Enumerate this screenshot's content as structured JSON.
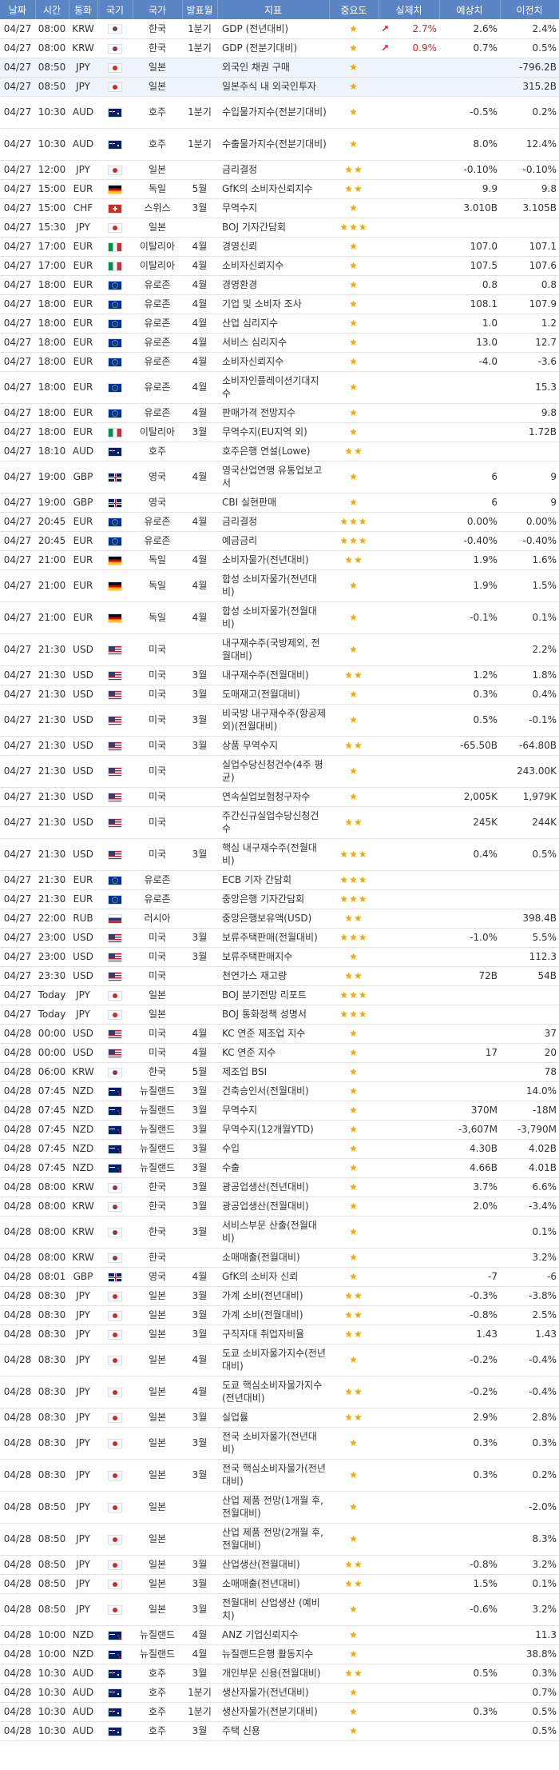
{
  "headers": [
    "날짜",
    "시간",
    "통화",
    "국기",
    "국가",
    "발표월",
    "지표",
    "중요도",
    "실제치",
    "예상치",
    "이전치"
  ],
  "rows": [
    [
      "04/27",
      "08:00",
      "KRW",
      "kr",
      "한국",
      "1분기",
      "GDP (전년대비)",
      1,
      "2.7%",
      "2.6%",
      "2.4%",
      "up"
    ],
    [
      "04/27",
      "08:00",
      "KRW",
      "kr",
      "한국",
      "1분기",
      "GDP (전분기대비)",
      1,
      "0.9%",
      "0.7%",
      "0.5%",
      "up"
    ],
    [
      "04/27",
      "08:50",
      "JPY",
      "jp",
      "일본",
      "",
      "외국인 채권 구매",
      1,
      "",
      "",
      "-796.2B",
      ""
    ],
    [
      "04/27",
      "08:50",
      "JPY",
      "jp",
      "일본",
      "",
      "일본주식 내 외국인투자",
      1,
      "",
      "",
      "315.2B",
      ""
    ],
    [
      "04/27",
      "10:30",
      "AUD",
      "au",
      "호주",
      "1분기",
      "수입물가지수(전분기대비)",
      1,
      "",
      "-0.5%",
      "0.2%",
      ""
    ],
    [
      "04/27",
      "10:30",
      "AUD",
      "au",
      "호주",
      "1분기",
      "수출물가지수(전분기대비)",
      1,
      "",
      "8.0%",
      "12.4%",
      ""
    ],
    [
      "04/27",
      "12:00",
      "JPY",
      "jp",
      "일본",
      "",
      "금리결정",
      2,
      "",
      "-0.10%",
      "-0.10%",
      ""
    ],
    [
      "04/27",
      "15:00",
      "EUR",
      "de",
      "독일",
      "5월",
      "GfK의 소비자신뢰지수",
      2,
      "",
      "9.9",
      "9.8",
      ""
    ],
    [
      "04/27",
      "15:00",
      "CHF",
      "ch",
      "스위스",
      "3월",
      "무역수지",
      1,
      "",
      "3.010B",
      "3.105B",
      ""
    ],
    [
      "04/27",
      "15:30",
      "JPY",
      "jp",
      "일본",
      "",
      "BOJ 기자간담회",
      3,
      "",
      "",
      "",
      ""
    ],
    [
      "04/27",
      "17:00",
      "EUR",
      "it",
      "이탈리아",
      "4월",
      "경영신뢰",
      1,
      "",
      "107.0",
      "107.1",
      ""
    ],
    [
      "04/27",
      "17:00",
      "EUR",
      "it",
      "이탈리아",
      "4월",
      "소비자신뢰지수",
      1,
      "",
      "107.5",
      "107.6",
      ""
    ],
    [
      "04/27",
      "18:00",
      "EUR",
      "eu",
      "유로존",
      "4월",
      "경영환경",
      1,
      "",
      "0.8",
      "0.8",
      ""
    ],
    [
      "04/27",
      "18:00",
      "EUR",
      "eu",
      "유로존",
      "4월",
      "기업 및 소비자 조사",
      1,
      "",
      "108.1",
      "107.9",
      ""
    ],
    [
      "04/27",
      "18:00",
      "EUR",
      "eu",
      "유로존",
      "4월",
      "산업 심리지수",
      1,
      "",
      "1.0",
      "1.2",
      ""
    ],
    [
      "04/27",
      "18:00",
      "EUR",
      "eu",
      "유로존",
      "4월",
      "서비스 심리지수",
      1,
      "",
      "13.0",
      "12.7",
      ""
    ],
    [
      "04/27",
      "18:00",
      "EUR",
      "eu",
      "유로존",
      "4월",
      "소비자신뢰지수",
      1,
      "",
      "-4.0",
      "-3.6",
      ""
    ],
    [
      "04/27",
      "18:00",
      "EUR",
      "eu",
      "유로존",
      "4월",
      "소비자인플레이션기대지수",
      1,
      "",
      "",
      "15.3",
      ""
    ],
    [
      "04/27",
      "18:00",
      "EUR",
      "eu",
      "유로존",
      "4월",
      "판매가격 전망지수",
      1,
      "",
      "",
      "9.8",
      ""
    ],
    [
      "04/27",
      "18:00",
      "EUR",
      "it",
      "이탈리아",
      "3월",
      "무역수지(EU지역 외)",
      1,
      "",
      "",
      "1.72B",
      ""
    ],
    [
      "04/27",
      "18:10",
      "AUD",
      "au",
      "호주",
      "",
      "호주은행 연설(Lowe)",
      2,
      "",
      "",
      "",
      ""
    ],
    [
      "04/27",
      "19:00",
      "GBP",
      "gb",
      "영국",
      "4월",
      "영국산업연맹 유통업보고서",
      1,
      "",
      "6",
      "9",
      ""
    ],
    [
      "04/27",
      "19:00",
      "GBP",
      "gb",
      "영국",
      "",
      "CBI 실현판매",
      1,
      "",
      "6",
      "9",
      ""
    ],
    [
      "04/27",
      "20:45",
      "EUR",
      "eu",
      "유로존",
      "4월",
      "금리결정",
      3,
      "",
      "0.00%",
      "0.00%",
      ""
    ],
    [
      "04/27",
      "20:45",
      "EUR",
      "eu",
      "유로존",
      "",
      "예금금리",
      3,
      "",
      "-0.40%",
      "-0.40%",
      ""
    ],
    [
      "04/27",
      "21:00",
      "EUR",
      "de",
      "독일",
      "4월",
      "소비자물가(전년대비)",
      2,
      "",
      "1.9%",
      "1.6%",
      ""
    ],
    [
      "04/27",
      "21:00",
      "EUR",
      "de",
      "독일",
      "4월",
      "합성 소비자물가(전년대비)",
      1,
      "",
      "1.9%",
      "1.5%",
      ""
    ],
    [
      "04/27",
      "21:00",
      "EUR",
      "de",
      "독일",
      "4월",
      "합성 소비자물가(전월대비)",
      1,
      "",
      "-0.1%",
      "0.1%",
      ""
    ],
    [
      "04/27",
      "21:30",
      "USD",
      "us",
      "미국",
      "",
      "내구재수주(국방제외, 전월대비)",
      1,
      "",
      "",
      "2.2%",
      ""
    ],
    [
      "04/27",
      "21:30",
      "USD",
      "us",
      "미국",
      "3월",
      "내구재수주(전월대비)",
      2,
      "",
      "1.2%",
      "1.8%",
      ""
    ],
    [
      "04/27",
      "21:30",
      "USD",
      "us",
      "미국",
      "3월",
      "도매재고(전월대비)",
      1,
      "",
      "0.3%",
      "0.4%",
      ""
    ],
    [
      "04/27",
      "21:30",
      "USD",
      "us",
      "미국",
      "3월",
      "비국방 내구재수주(항공제외)(전월대비)",
      1,
      "",
      "0.5%",
      "-0.1%",
      ""
    ],
    [
      "04/27",
      "21:30",
      "USD",
      "us",
      "미국",
      "3월",
      "상품 무역수지",
      2,
      "",
      "-65.50B",
      "-64.80B",
      ""
    ],
    [
      "04/27",
      "21:30",
      "USD",
      "us",
      "미국",
      "",
      "실업수당신청건수(4주 평균)",
      1,
      "",
      "",
      "243.00K",
      ""
    ],
    [
      "04/27",
      "21:30",
      "USD",
      "us",
      "미국",
      "",
      "연속실업보험청구자수",
      1,
      "",
      "2,005K",
      "1,979K",
      ""
    ],
    [
      "04/27",
      "21:30",
      "USD",
      "us",
      "미국",
      "",
      "주간신규실업수당신청건수",
      2,
      "",
      "245K",
      "244K",
      ""
    ],
    [
      "04/27",
      "21:30",
      "USD",
      "us",
      "미국",
      "3월",
      "핵심 내구재수주(전월대비)",
      3,
      "",
      "0.4%",
      "0.5%",
      ""
    ],
    [
      "04/27",
      "21:30",
      "EUR",
      "eu",
      "유로존",
      "",
      "ECB 기자 간담회",
      3,
      "",
      "",
      "",
      ""
    ],
    [
      "04/27",
      "21:30",
      "EUR",
      "eu",
      "유로존",
      "",
      "중앙은행 기자간담회",
      3,
      "",
      "",
      "",
      ""
    ],
    [
      "04/27",
      "22:00",
      "RUB",
      "ru",
      "러시아",
      "",
      "중앙은행보유액(USD)",
      2,
      "",
      "",
      "398.4B",
      ""
    ],
    [
      "04/27",
      "23:00",
      "USD",
      "us",
      "미국",
      "3월",
      "보류주택판매(전월대비)",
      3,
      "",
      "-1.0%",
      "5.5%",
      ""
    ],
    [
      "04/27",
      "23:00",
      "USD",
      "us",
      "미국",
      "3월",
      "보류주택판매지수",
      1,
      "",
      "",
      "112.3",
      ""
    ],
    [
      "04/27",
      "23:30",
      "USD",
      "us",
      "미국",
      "",
      "천연가스 재고량",
      2,
      "",
      "72B",
      "54B",
      ""
    ],
    [
      "04/27",
      "Today",
      "JPY",
      "jp",
      "일본",
      "",
      "BOJ 분기전망 리포트",
      3,
      "",
      "",
      "",
      ""
    ],
    [
      "04/27",
      "Today",
      "JPY",
      "jp",
      "일본",
      "",
      "BOJ 통화정책 성명서",
      3,
      "",
      "",
      "",
      ""
    ],
    [
      "04/28",
      "00:00",
      "USD",
      "us",
      "미국",
      "4월",
      "KC 연준 제조업 지수",
      1,
      "",
      "",
      "37",
      ""
    ],
    [
      "04/28",
      "00:00",
      "USD",
      "us",
      "미국",
      "4월",
      "KC 연준 지수",
      1,
      "",
      "17",
      "20",
      ""
    ],
    [
      "04/28",
      "06:00",
      "KRW",
      "kr",
      "한국",
      "5월",
      "제조업 BSI",
      1,
      "",
      "",
      "78",
      ""
    ],
    [
      "04/28",
      "07:45",
      "NZD",
      "nz",
      "뉴질랜드",
      "3월",
      "건축승인서(전월대비)",
      1,
      "",
      "",
      "14.0%",
      ""
    ],
    [
      "04/28",
      "07:45",
      "NZD",
      "nz",
      "뉴질랜드",
      "3월",
      "무역수지",
      1,
      "",
      "370M",
      "-18M",
      ""
    ],
    [
      "04/28",
      "07:45",
      "NZD",
      "nz",
      "뉴질랜드",
      "3월",
      "무역수지(12개월YTD)",
      1,
      "",
      "-3,607M",
      "-3,790M",
      ""
    ],
    [
      "04/28",
      "07:45",
      "NZD",
      "nz",
      "뉴질랜드",
      "3월",
      "수입",
      1,
      "",
      "4.30B",
      "4.02B",
      ""
    ],
    [
      "04/28",
      "07:45",
      "NZD",
      "nz",
      "뉴질랜드",
      "3월",
      "수출",
      1,
      "",
      "4.66B",
      "4.01B",
      ""
    ],
    [
      "04/28",
      "08:00",
      "KRW",
      "kr",
      "한국",
      "3월",
      "광공업생산(전년대비)",
      1,
      "",
      "3.7%",
      "6.6%",
      ""
    ],
    [
      "04/28",
      "08:00",
      "KRW",
      "kr",
      "한국",
      "3월",
      "광공업생산(전월대비)",
      1,
      "",
      "2.0%",
      "-3.4%",
      ""
    ],
    [
      "04/28",
      "08:00",
      "KRW",
      "kr",
      "한국",
      "3월",
      "서비스부문 산출(전월대비)",
      1,
      "",
      "",
      "0.1%",
      ""
    ],
    [
      "04/28",
      "08:00",
      "KRW",
      "kr",
      "한국",
      "",
      "소매매출(전월대비)",
      1,
      "",
      "",
      "3.2%",
      ""
    ],
    [
      "04/28",
      "08:01",
      "GBP",
      "gb",
      "영국",
      "4월",
      "GfK의 소비자 신뢰",
      1,
      "",
      "-7",
      "-6",
      ""
    ],
    [
      "04/28",
      "08:30",
      "JPY",
      "jp",
      "일본",
      "3월",
      "가계 소비(전년대비)",
      2,
      "",
      "-0.3%",
      "-3.8%",
      ""
    ],
    [
      "04/28",
      "08:30",
      "JPY",
      "jp",
      "일본",
      "3월",
      "가계 소비(전월대비)",
      2,
      "",
      "-0.8%",
      "2.5%",
      ""
    ],
    [
      "04/28",
      "08:30",
      "JPY",
      "jp",
      "일본",
      "3월",
      "구직자대 취업자비율",
      2,
      "",
      "1.43",
      "1.43",
      ""
    ],
    [
      "04/28",
      "08:30",
      "JPY",
      "jp",
      "일본",
      "4월",
      "도쿄 소비자물가지수(전년대비)",
      1,
      "",
      "-0.2%",
      "-0.4%",
      ""
    ],
    [
      "04/28",
      "08:30",
      "JPY",
      "jp",
      "일본",
      "4월",
      "도쿄 핵심소비자물가지수(전년대비)",
      2,
      "",
      "-0.2%",
      "-0.4%",
      ""
    ],
    [
      "04/28",
      "08:30",
      "JPY",
      "jp",
      "일본",
      "3월",
      "실업률",
      2,
      "",
      "2.9%",
      "2.8%",
      ""
    ],
    [
      "04/28",
      "08:30",
      "JPY",
      "jp",
      "일본",
      "3월",
      "전국 소비자물가(전년대비)",
      1,
      "",
      "0.3%",
      "0.3%",
      ""
    ],
    [
      "04/28",
      "08:30",
      "JPY",
      "jp",
      "일본",
      "3월",
      "전국 핵심소비자물가(전년대비)",
      1,
      "",
      "0.3%",
      "0.2%",
      ""
    ],
    [
      "04/28",
      "08:50",
      "JPY",
      "jp",
      "일본",
      "",
      "산업 제품 전망(1개월 후, 전월대비)",
      1,
      "",
      "",
      "-2.0%",
      ""
    ],
    [
      "04/28",
      "08:50",
      "JPY",
      "jp",
      "일본",
      "",
      "산업 제품 전망(2개월 후, 전월대비)",
      1,
      "",
      "",
      "8.3%",
      ""
    ],
    [
      "04/28",
      "08:50",
      "JPY",
      "jp",
      "일본",
      "3월",
      "산업생산(전월대비)",
      2,
      "",
      "-0.8%",
      "3.2%",
      ""
    ],
    [
      "04/28",
      "08:50",
      "JPY",
      "jp",
      "일본",
      "3월",
      "소매매출(전년대비)",
      2,
      "",
      "1.5%",
      "0.1%",
      ""
    ],
    [
      "04/28",
      "08:50",
      "JPY",
      "jp",
      "일본",
      "3월",
      "전월대비 산업생산 (예비치)",
      1,
      "",
      "-0.6%",
      "3.2%",
      ""
    ],
    [
      "04/28",
      "10:00",
      "NZD",
      "nz",
      "뉴질랜드",
      "4월",
      "ANZ 기업신뢰지수",
      1,
      "",
      "",
      "11.3",
      ""
    ],
    [
      "04/28",
      "10:00",
      "NZD",
      "nz",
      "뉴질랜드",
      "4월",
      "뉴질랜드은행 활동지수",
      1,
      "",
      "",
      "38.8%",
      ""
    ],
    [
      "04/28",
      "10:30",
      "AUD",
      "au",
      "호주",
      "3월",
      "개인부문 신용(전월대비)",
      2,
      "",
      "0.5%",
      "0.3%",
      ""
    ],
    [
      "04/28",
      "10:30",
      "AUD",
      "au",
      "호주",
      "1분기",
      "생산자물가(전년대비)",
      1,
      "",
      "",
      "0.7%",
      ""
    ],
    [
      "04/28",
      "10:30",
      "AUD",
      "au",
      "호주",
      "1분기",
      "생산자물가(전분기대비)",
      1,
      "",
      "0.3%",
      "0.5%",
      ""
    ],
    [
      "04/28",
      "10:30",
      "AUD",
      "au",
      "호주",
      "3월",
      "주택 신용",
      1,
      "",
      "",
      "0.5%",
      ""
    ]
  ],
  "tall_rows": [
    4,
    5,
    17,
    21,
    26,
    27,
    28,
    31,
    33,
    35,
    36,
    55,
    61,
    62,
    64,
    65,
    66,
    67,
    70
  ],
  "hl_rows": [
    2,
    3
  ]
}
